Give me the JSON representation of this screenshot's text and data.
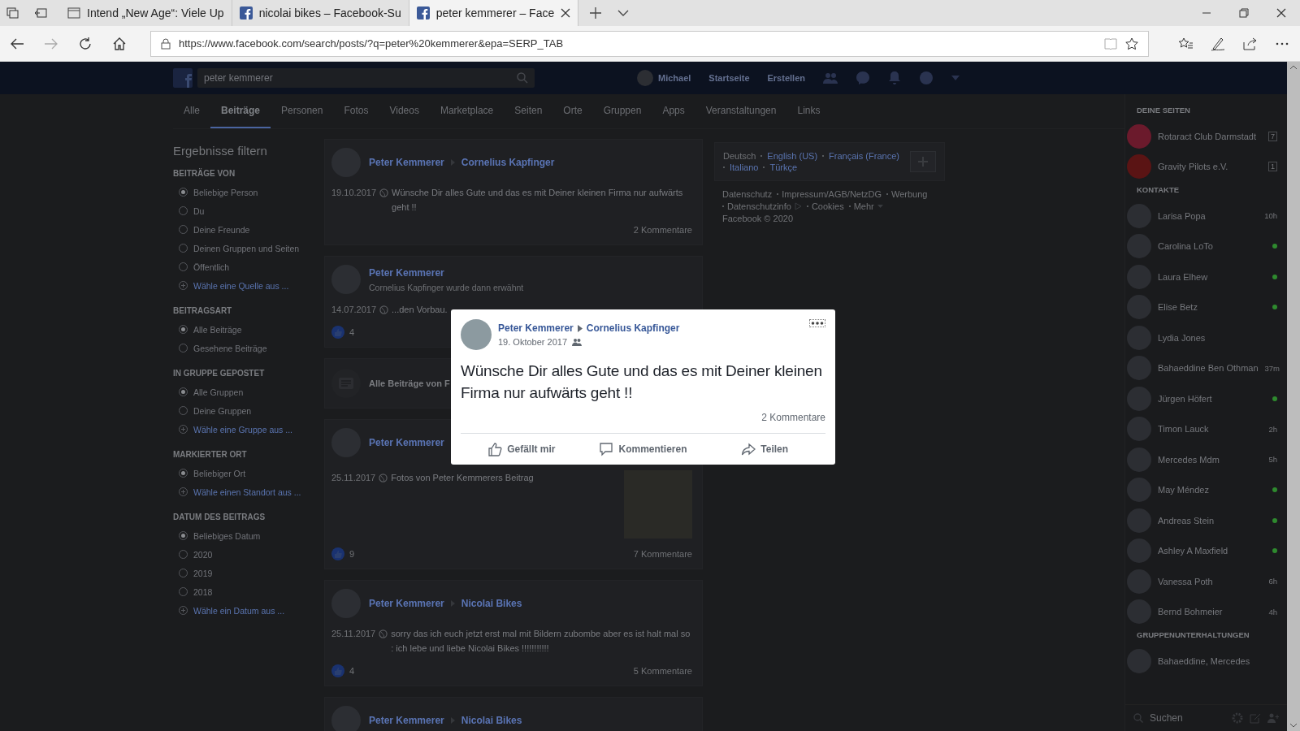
{
  "browser": {
    "tabs": [
      {
        "title": "Intend „New Age“: Viele Up",
        "kind": "page",
        "selected": false
      },
      {
        "title": "nicolai bikes – Facebook-Su",
        "kind": "facebook",
        "selected": false
      },
      {
        "title": "peter kemmerer – Face",
        "kind": "facebook",
        "selected": true
      }
    ],
    "url": "https://www.facebook.com/search/posts/?q=peter%20kemmerer&epa=SERP_TAB"
  },
  "header": {
    "search_value": "peter kemmerer",
    "profile_name": "Michael",
    "links": [
      "Startseite",
      "Erstellen"
    ]
  },
  "tabs": [
    {
      "label": "Alle",
      "selected": false
    },
    {
      "label": "Beiträge",
      "selected": true
    },
    {
      "label": "Personen",
      "selected": false
    },
    {
      "label": "Fotos",
      "selected": false
    },
    {
      "label": "Videos",
      "selected": false
    },
    {
      "label": "Marketplace",
      "selected": false
    },
    {
      "label": "Seiten",
      "selected": false
    },
    {
      "label": "Orte",
      "selected": false
    },
    {
      "label": "Gruppen",
      "selected": false
    },
    {
      "label": "Apps",
      "selected": false
    },
    {
      "label": "Veranstaltungen",
      "selected": false
    },
    {
      "label": "Links",
      "selected": false
    }
  ],
  "filters": {
    "title": "Ergebnisse filtern",
    "sections": [
      {
        "heading": "BEITRÄGE VON",
        "options": [
          {
            "label": "Beliebige Person",
            "kind": "radio",
            "selected": true
          },
          {
            "label": "Du",
            "kind": "radio",
            "selected": false
          },
          {
            "label": "Deine Freunde",
            "kind": "radio",
            "selected": false
          },
          {
            "label": "Deinen Gruppen und Seiten",
            "kind": "radio",
            "selected": false
          },
          {
            "label": "Öffentlich",
            "kind": "radio",
            "selected": false
          },
          {
            "label": "Wähle eine Quelle aus ...",
            "kind": "add"
          }
        ]
      },
      {
        "heading": "BEITRAGSART",
        "options": [
          {
            "label": "Alle Beiträge",
            "kind": "radio",
            "selected": true
          },
          {
            "label": "Gesehene Beiträge",
            "kind": "radio",
            "selected": false
          }
        ]
      },
      {
        "heading": "IN GRUPPE GEPOSTET",
        "options": [
          {
            "label": "Alle Gruppen",
            "kind": "radio",
            "selected": true
          },
          {
            "label": "Deine Gruppen",
            "kind": "radio",
            "selected": false
          },
          {
            "label": "Wähle eine Gruppe aus ...",
            "kind": "add"
          }
        ]
      },
      {
        "heading": "MARKIERTER ORT",
        "options": [
          {
            "label": "Beliebiger Ort",
            "kind": "radio",
            "selected": true
          },
          {
            "label": "Wähle einen Standort aus ...",
            "kind": "add"
          }
        ]
      },
      {
        "heading": "DATUM DES BEITRAGS",
        "options": [
          {
            "label": "Beliebiges Datum",
            "kind": "radio",
            "selected": true
          },
          {
            "label": "2020",
            "kind": "radio",
            "selected": false
          },
          {
            "label": "2019",
            "kind": "radio",
            "selected": false
          },
          {
            "label": "2018",
            "kind": "radio",
            "selected": false
          },
          {
            "label": "Wähle ein Datum aus ...",
            "kind": "add"
          }
        ]
      }
    ]
  },
  "feed": [
    {
      "kind": "post",
      "author": "Peter Kemmerer",
      "target": "Cornelius Kapfinger",
      "date": "19.10.2017",
      "text": "Wünsche Dir alles Gute und das es mit Deiner kleinen Firma nur aufwärts geht !!",
      "comments": "2 Kommentare"
    },
    {
      "kind": "post",
      "author": "Peter Kemmerer",
      "subline": "Cornelius Kapfinger wurde dann erwähnt",
      "date": "14.07.2017",
      "text": "...den Vorbau.",
      "likes": "4"
    },
    {
      "kind": "summary",
      "text": "Alle Beiträge von F"
    },
    {
      "kind": "post",
      "author": "Peter Kemmerer",
      "date": "25.11.2017",
      "text": "Fotos von Peter Kemmerers Beitrag",
      "photo": true,
      "likes": "9",
      "comments": "7 Kommentare"
    },
    {
      "kind": "post",
      "author": "Peter Kemmerer",
      "target": "Nicolai Bikes",
      "date": "25.11.2017",
      "text": "sorry das ich euch jetzt erst mal mit Bildern zubombe aber es ist halt mal so : ich lebe und liebe Nicolai Bikes !!!!!!!!!!!",
      "likes": "4",
      "comments": "5 Kommentare"
    },
    {
      "kind": "post",
      "author": "Peter Kemmerer",
      "target": "Nicolai Bikes"
    }
  ],
  "languages": [
    {
      "label": "Deutsch",
      "current": true
    },
    {
      "label": "English (US)",
      "current": false
    },
    {
      "label": "Français (France)",
      "current": false
    },
    {
      "label": "Italiano",
      "current": false
    },
    {
      "label": "Türkçe",
      "current": false
    }
  ],
  "footer": {
    "links": [
      "Datenschutz",
      "Impressum/AGB/NetzDG",
      "Werbung",
      "Datenschutzinfo",
      "Cookies",
      "Mehr"
    ],
    "copyright": "Facebook © 2020"
  },
  "sidebar": {
    "sections": [
      {
        "heading": "DEINE SEITEN",
        "kind": "pages",
        "items": [
          {
            "name": "Rotaract Club Darmstadt",
            "badge": "7",
            "color": "#6b1a2c"
          },
          {
            "name": "Gravity Pilots e.V.",
            "badge": "1",
            "color": "#5a1414"
          }
        ]
      },
      {
        "heading": "KONTAKTE",
        "kind": "contacts",
        "items": [
          {
            "name": "Larisa Popa",
            "online": false,
            "last_active": "10h"
          },
          {
            "name": "Carolina LoTo",
            "online": true
          },
          {
            "name": "Laura Elhew",
            "online": true
          },
          {
            "name": "Elise Betz",
            "online": true
          },
          {
            "name": "Lydia Jones",
            "online": false
          },
          {
            "name": "Bahaeddine Ben Othman",
            "online": false,
            "last_active": "37m"
          },
          {
            "name": "Jürgen Höfert",
            "online": true
          },
          {
            "name": "Timon Lauck",
            "online": false,
            "last_active": "2h"
          },
          {
            "name": "Mercedes Mdm",
            "online": false,
            "last_active": "5h"
          },
          {
            "name": "May Méndez",
            "online": true
          },
          {
            "name": "Andreas Stein",
            "online": true
          },
          {
            "name": "Ashley A Maxfield",
            "online": true
          },
          {
            "name": "Vanessa Poth",
            "online": false,
            "last_active": "6h"
          },
          {
            "name": "Bernd Bohmeier",
            "online": false,
            "last_active": "4h"
          }
        ]
      },
      {
        "heading": "GRUPPENUNTERHALTUNGEN",
        "kind": "groups",
        "items": [
          {
            "name": "Bahaeddine, Mercedes"
          }
        ]
      }
    ],
    "search_placeholder": "Suchen"
  },
  "modal": {
    "author": "Peter Kemmerer",
    "target": "Cornelius Kapfinger",
    "date": "19. Oktober 2017",
    "text": "Wünsche Dir alles Gute und das es mit Deiner kleinen Firma nur aufwärts geht !!",
    "comments": "2 Kommentare",
    "actions": [
      {
        "label": "Gefällt mir",
        "kind": "like"
      },
      {
        "label": "Kommentieren",
        "kind": "comment"
      },
      {
        "label": "Teilen",
        "kind": "share"
      }
    ]
  }
}
